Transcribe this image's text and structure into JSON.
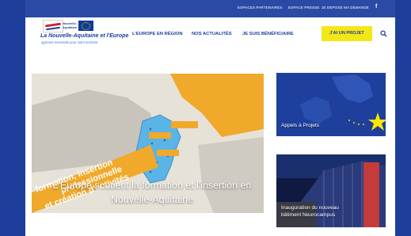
{
  "topbar": {
    "links": [
      "ESPACES PARTENAIRES",
      "ESPACE PRESSE",
      "JE DÉPOSE MA DEMANDE"
    ],
    "social": "f"
  },
  "logo": {
    "region_name": "Nouvelle-Aquitaine",
    "title": "La Nouvelle-Aquitaine et l'Europe",
    "subtitle": "agissent ensemble pour votre territoire"
  },
  "nav": {
    "items": [
      "L'EUROPE EN RÉGION",
      "NOS ACTUALITÉS",
      "JE SUIS BÉNÉFICIAIRE"
    ],
    "cta": "J'AI UN PROJET",
    "search_icon": "search-icon"
  },
  "main_card": {
    "title": "L'Europe soutient la formation et l'insertion en Nouvelle-Aquitaine",
    "banner_lines": [
      "formation, insertion",
      "professionnelle",
      "et création d'activités"
    ]
  },
  "side_cards": [
    {
      "title": "Appels à Projets"
    },
    {
      "title": "Inauguration du nouveau bâtiment Neurocampus"
    }
  ],
  "colors": {
    "page_bg": "#1d3e9a",
    "topbar": "#2a4aa6",
    "accent_yellow": "#f3e817",
    "brand_blue": "#1d3e9a",
    "map_orange": "#f0a92b",
    "map_blue": "#5ab4e6"
  }
}
